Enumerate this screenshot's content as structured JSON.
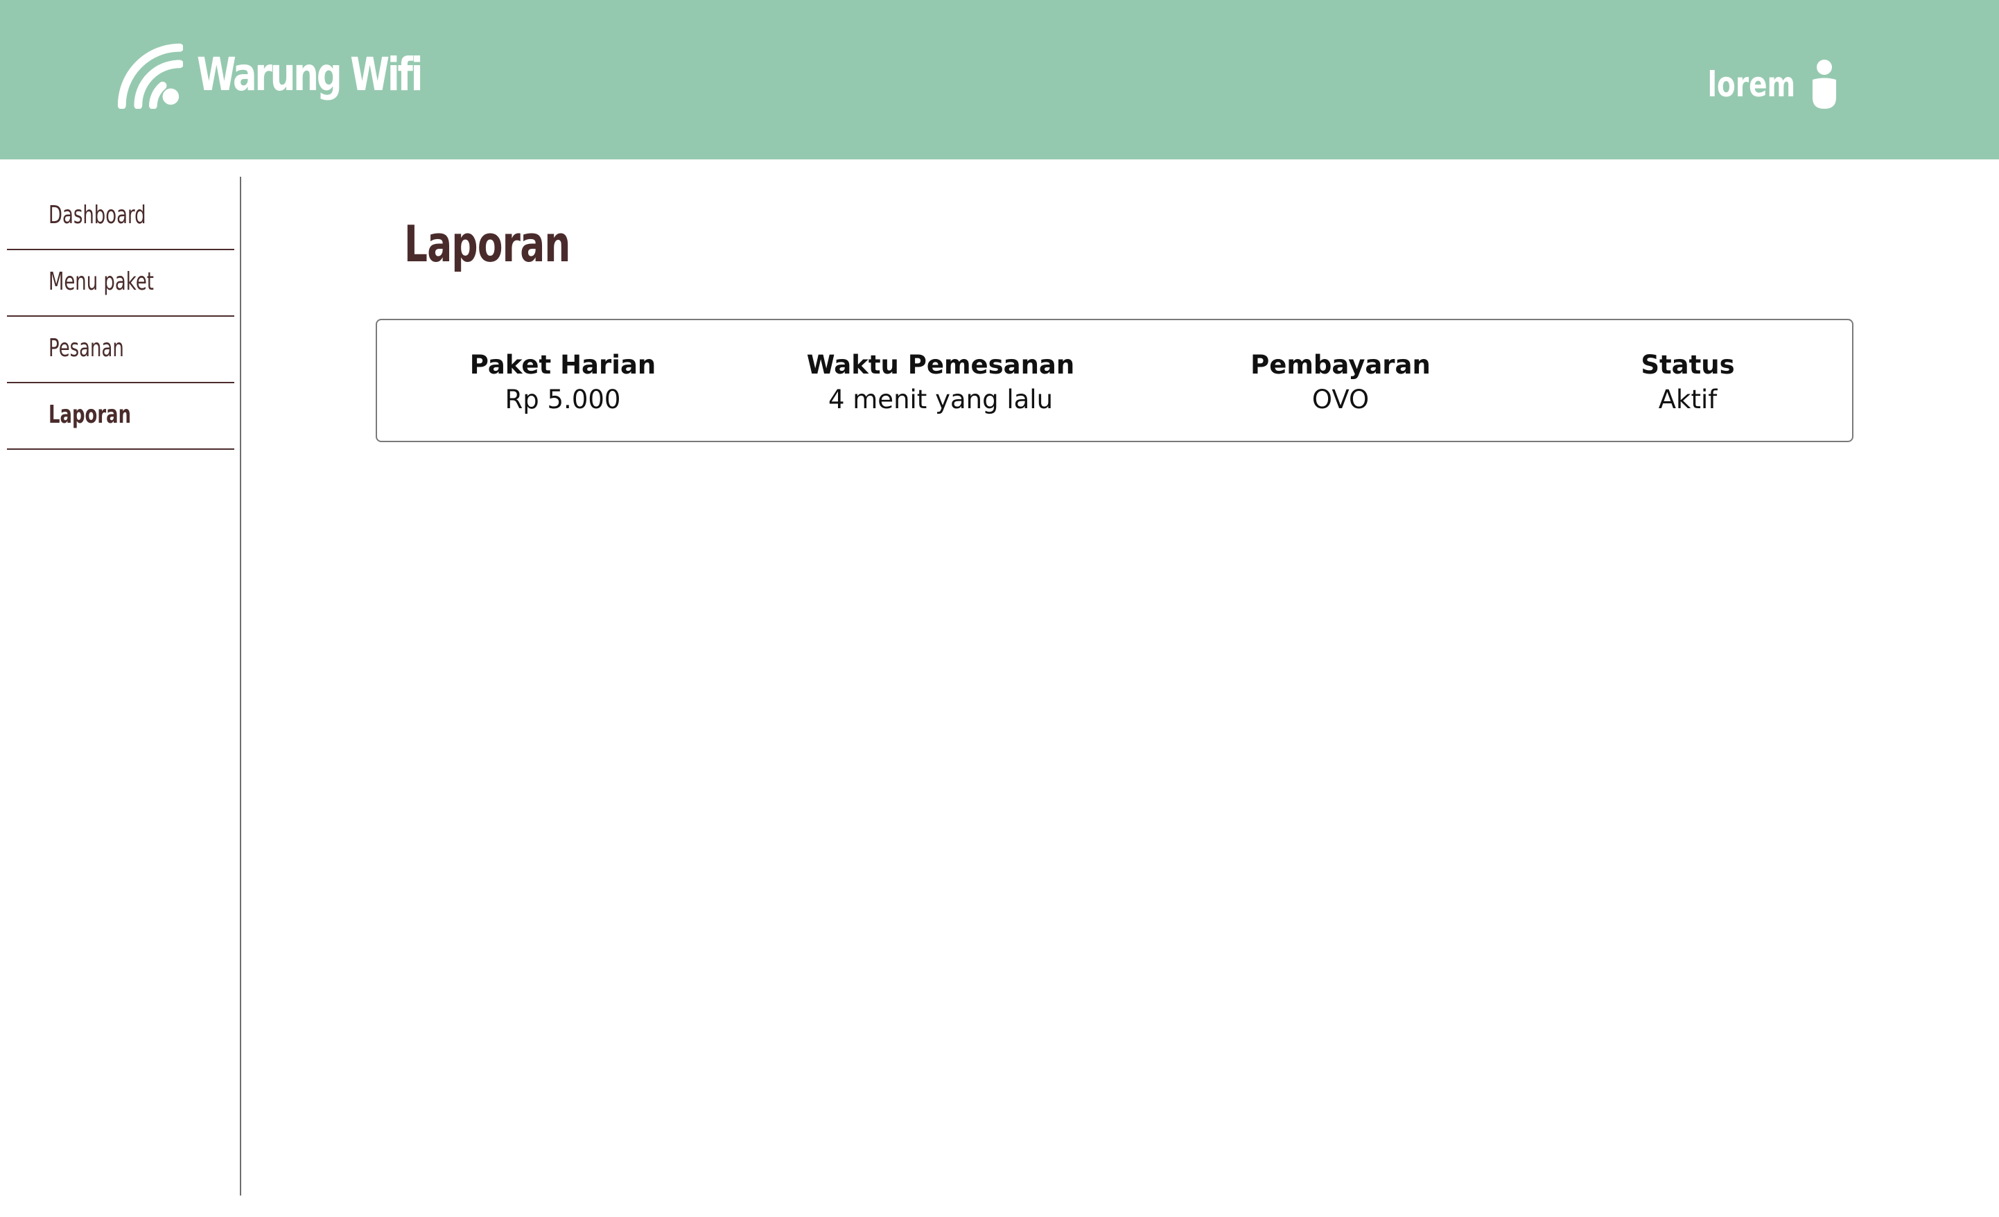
{
  "header": {
    "brand_title": "Warung Wifi",
    "brand_icon": "wifi-icon",
    "user_name": "lorem",
    "user_icon": "user-icon",
    "background_color": "#95c9af"
  },
  "sidebar": {
    "items": [
      {
        "label": "Dashboard",
        "active": false
      },
      {
        "label": "Menu paket",
        "active": false
      },
      {
        "label": "Pesanan",
        "active": false
      },
      {
        "label": "Laporan",
        "active": true
      }
    ]
  },
  "main": {
    "title": "Laporan",
    "report": {
      "columns": [
        {
          "header": "Paket Harian",
          "value": "Rp 5.000"
        },
        {
          "header": "Waktu Pemesanan",
          "value": "4 menit yang lalu"
        },
        {
          "header": "Pembayaran",
          "value": "OVO"
        },
        {
          "header": "Status",
          "value": "Aktif"
        }
      ]
    }
  },
  "colors": {
    "accent": "#95c9af",
    "text_brown": "#4a2b2b"
  }
}
